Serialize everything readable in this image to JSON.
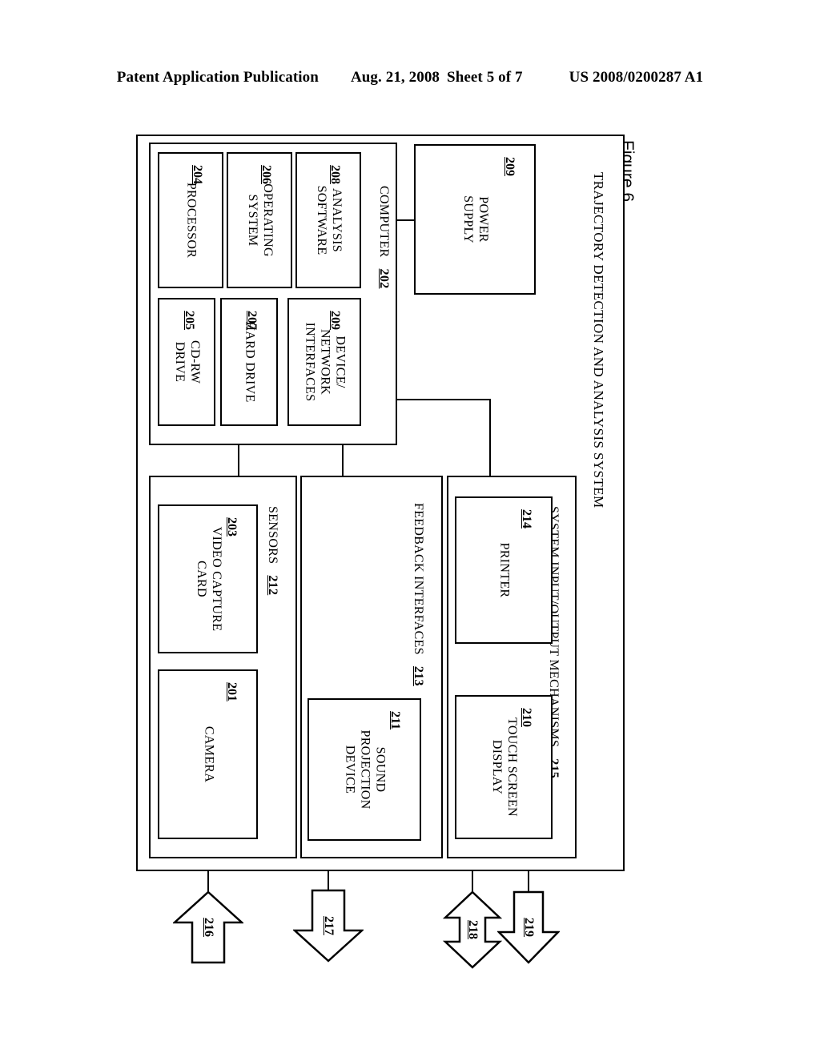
{
  "header": {
    "publication": "Patent Application Publication",
    "date": "Aug. 21, 2008",
    "sheet": "Sheet 5 of 7",
    "patent_number": "US 2008/0200287 A1"
  },
  "figure": {
    "caption": "Figure 6"
  },
  "system": {
    "label": "TRAJECTORY DETECTION AND ANALYSIS SYSTEM"
  },
  "computer": {
    "label": "COMPUTER",
    "number": "202",
    "blocks": [
      {
        "label": "PROCESSOR",
        "number": "204"
      },
      {
        "label": "OPERATING\nSYSTEM",
        "line1": "OPERATING",
        "line2": "SYSTEM",
        "number": "206"
      },
      {
        "label": "ANALYSIS\nSOFTWARE",
        "line1": "ANALYSIS",
        "line2": "SOFTWARE",
        "number": "208"
      },
      {
        "label": "CD-RW\nDRIVE",
        "line1": "CD-RW",
        "line2": "DRIVE",
        "number": "205"
      },
      {
        "label": "HARD DRIVE",
        "number": "207"
      },
      {
        "label": "DEVICE/\nNETWORK\nINTERFACES",
        "line1": "DEVICE/",
        "line2": "NETWORK",
        "line3": "INTERFACES",
        "number": "209"
      }
    ]
  },
  "power_supply": {
    "line1": "POWER",
    "line2": "SUPPLY",
    "number": "209"
  },
  "sensors": {
    "label": "SENSORS",
    "number": "212",
    "blocks": [
      {
        "line1": "VIDEO CAPTURE",
        "line2": "CARD",
        "number": "203"
      },
      {
        "line1": "CAMERA",
        "number": "201"
      }
    ]
  },
  "feedback": {
    "label": "FEEDBACK INTERFACES",
    "number": "213",
    "blocks": [
      {
        "line1": "SOUND",
        "line2": "PROJECTION",
        "line3": "DEVICE",
        "number": "211"
      }
    ]
  },
  "io": {
    "label": "SYSTEM INPUT/OUTPUT MECHANISMS",
    "number": "215",
    "blocks": [
      {
        "line1": "PRINTER",
        "number": "214"
      },
      {
        "line1": "TOUCH SCREEN",
        "line2": "DISPLAY",
        "number": "210"
      }
    ]
  },
  "arrows": [
    {
      "number": "216",
      "direction": "in"
    },
    {
      "number": "217",
      "direction": "out"
    },
    {
      "number": "218",
      "direction": "bidirectional"
    },
    {
      "number": "219",
      "direction": "out"
    }
  ]
}
